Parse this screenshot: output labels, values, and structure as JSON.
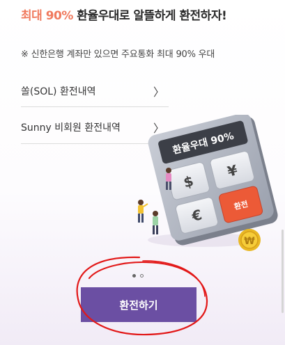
{
  "headline": {
    "accent": "최대 90%",
    "rest": " 환율우대로 알뜰하게 환전하자!"
  },
  "notice": "※ 신한은행 계좌만 있으면 주요통화 최대 90% 우대",
  "menu": {
    "items": [
      {
        "label": "쏠(SOL) 환전내역",
        "chevron": "〉"
      },
      {
        "label": "Sunny 비회원 환전내역",
        "chevron": "〉"
      }
    ]
  },
  "illustration": {
    "calculator_display": "환율우대 90%",
    "keys": [
      "$",
      "¥",
      "€",
      "환전"
    ],
    "coin_symbol": "₩"
  },
  "pager": {
    "total": 2,
    "active": 0
  },
  "cta": {
    "label": "환전하기"
  },
  "colors": {
    "accent": "#f07a5e",
    "primary": "#6b4fa3",
    "annotation": "#e21818"
  }
}
